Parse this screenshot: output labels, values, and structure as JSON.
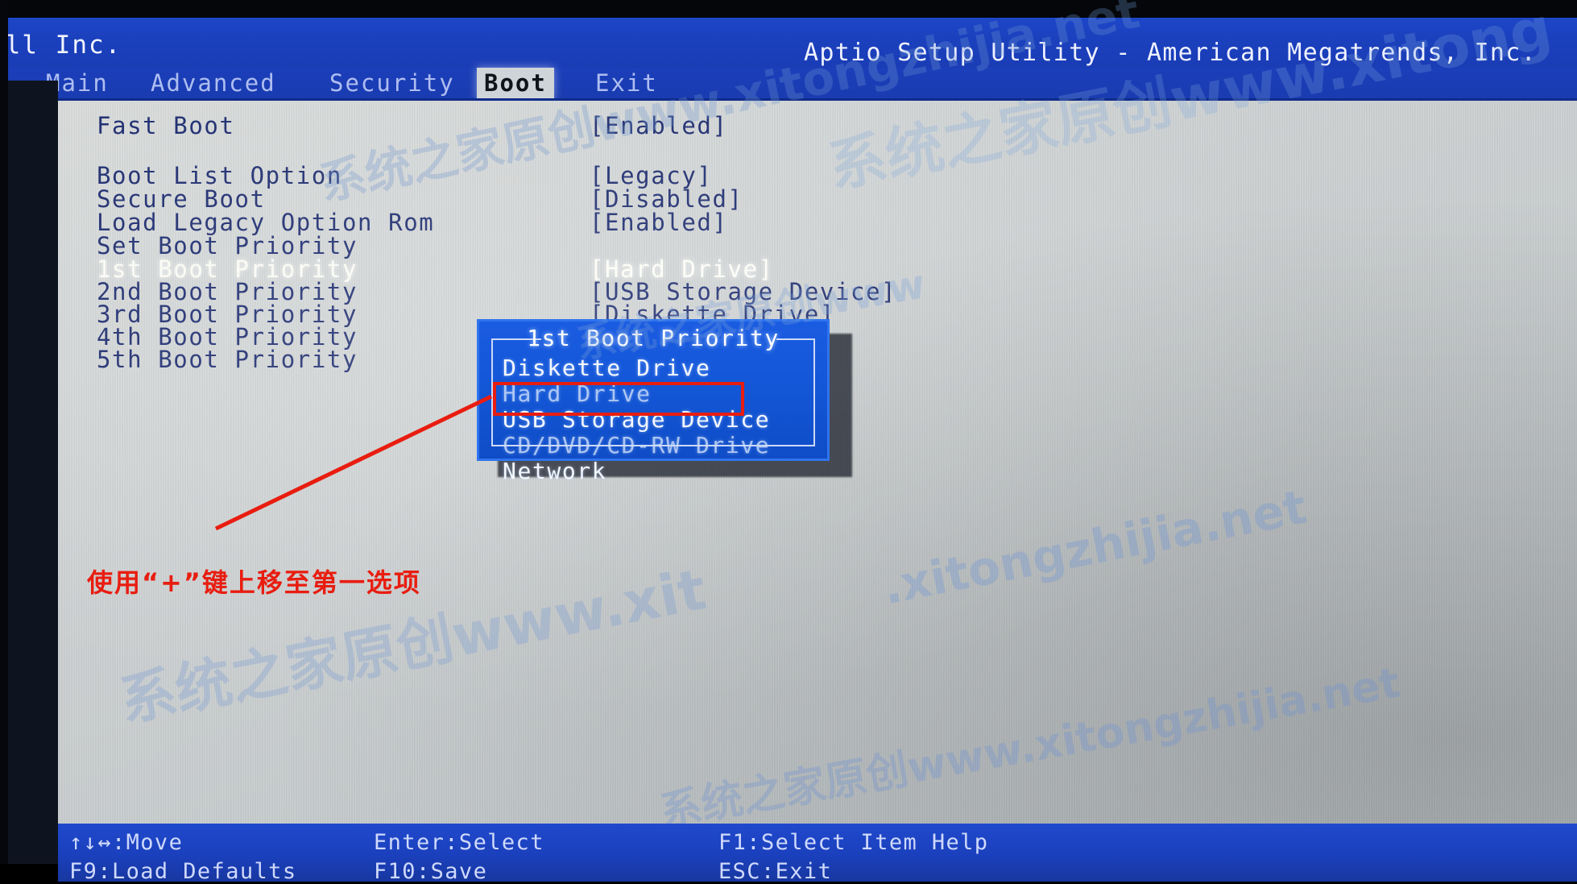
{
  "header": {
    "vendor": "ell Inc.",
    "utility_title": "Aptio Setup Utility - American Megatrends, Inc."
  },
  "tabs": [
    {
      "label": "Main",
      "active": false
    },
    {
      "label": "Advanced",
      "active": false
    },
    {
      "label": "Security",
      "active": false
    },
    {
      "label": "Boot",
      "active": true
    },
    {
      "label": "Exit",
      "active": false
    }
  ],
  "settings": [
    {
      "label": "Fast Boot",
      "value": "[Enabled]",
      "selected": false
    },
    {
      "label": "Boot List Option",
      "value": "[Legacy]",
      "selected": false
    },
    {
      "label": "Secure Boot",
      "value": "[Disabled]",
      "selected": false
    },
    {
      "label": "Load Legacy Option Rom",
      "value": "[Enabled]",
      "selected": false
    },
    {
      "label": "Set Boot Priority",
      "value": "",
      "selected": false
    },
    {
      "label": "1st Boot Priority",
      "value": "[Hard Drive]",
      "selected": true
    },
    {
      "label": "2nd Boot Priority",
      "value": "[USB Storage Device]",
      "selected": false
    },
    {
      "label": "3rd Boot Priority",
      "value": "[Diskette Drive]",
      "selected": false
    },
    {
      "label": "4th Boot Priority",
      "value": "",
      "selected": false
    },
    {
      "label": "5th Boot Priority",
      "value": "",
      "selected": false
    }
  ],
  "dialog": {
    "title": "1st Boot Priority",
    "options": [
      {
        "label": "Diskette Drive",
        "highlighted": false
      },
      {
        "label": "Hard Drive",
        "highlighted": false
      },
      {
        "label": "USB Storage Device",
        "highlighted": true
      },
      {
        "label": "CD/DVD/CD-RW Drive",
        "highlighted": false
      },
      {
        "label": "Network",
        "highlighted": false
      }
    ]
  },
  "annotation": {
    "text": "使用“+”键上移至第一选项",
    "color": "#e81d10"
  },
  "help_bar": [
    {
      "label": "↑↓↔:Move",
      "row": 0,
      "col": 0
    },
    {
      "label": "Enter:Select",
      "row": 0,
      "col": 1
    },
    {
      "label": "F1:Select Item Help",
      "row": 0,
      "col": 2
    },
    {
      "label": "F9:Load Defaults",
      "row": 1,
      "col": 0
    },
    {
      "label": "F10:Save",
      "row": 1,
      "col": 1
    },
    {
      "label": "ESC:Exit",
      "row": 1,
      "col": 2
    }
  ],
  "watermarks": [
    {
      "text": "系统之家原创www.xitongzhijia.net"
    },
    {
      "text": "系统之家原创www"
    },
    {
      "text": "系统之家原创www.xitong"
    },
    {
      "text": ".xitongzhijia.net"
    },
    {
      "text": "系统之家原创www.xit"
    },
    {
      "text": "系统之家原创www.xitongzhijia.net"
    }
  ],
  "colors": {
    "bios_blue": "#1a3cb4",
    "dialog_blue": "#1356d8",
    "panel_gray": "#cfd3d4",
    "annotation_red": "#e81d10",
    "text_navy": "#1b2a6e"
  }
}
